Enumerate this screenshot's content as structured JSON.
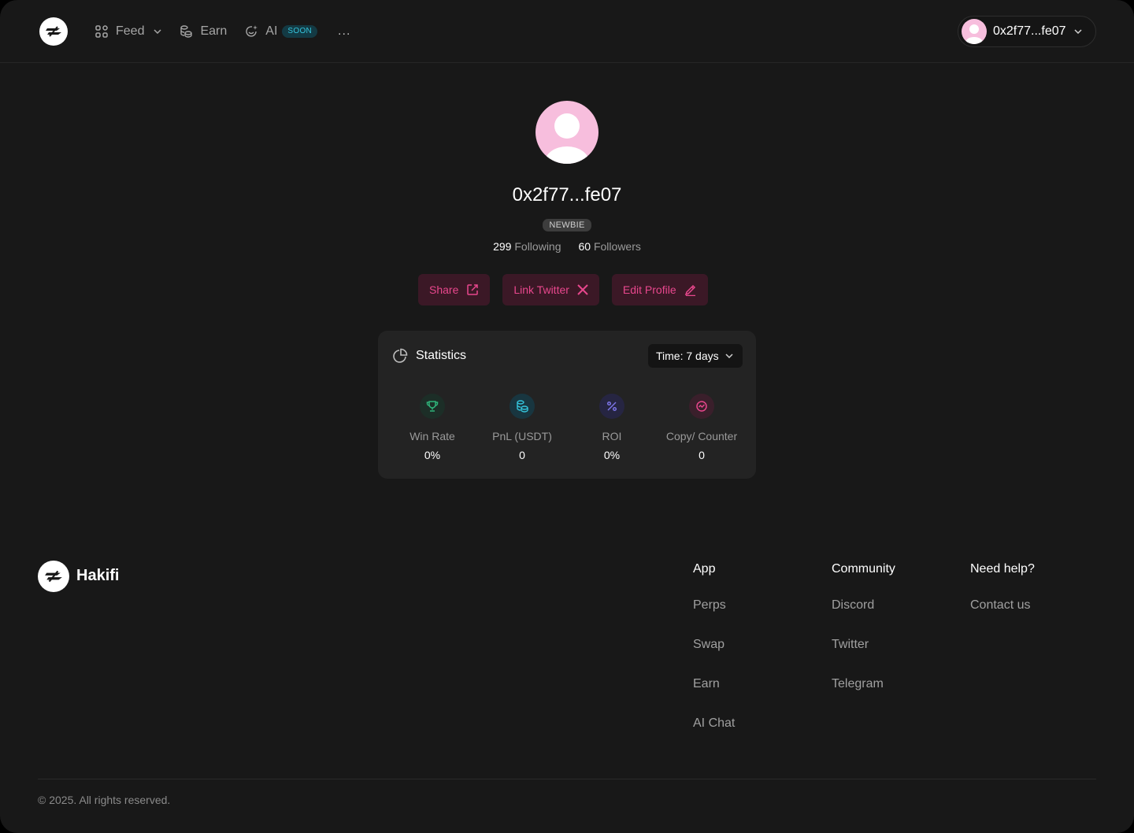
{
  "header": {
    "nav": [
      {
        "label": "Feed",
        "icon": "grid-icon",
        "has_dropdown": true
      },
      {
        "label": "Earn",
        "icon": "coins-icon"
      },
      {
        "label": "AI",
        "icon": "ai-sparkle-icon",
        "badge": "SOON"
      }
    ],
    "more_label": "...",
    "wallet_label": "0x2f77...fe07"
  },
  "profile": {
    "username": "0x2f77...fe07",
    "rank_badge": "NEWBIE",
    "following_count": "299",
    "following_label": "Following",
    "followers_count": "60",
    "followers_label": "Followers",
    "actions": {
      "share": "Share",
      "link_twitter": "Link Twitter",
      "edit_profile": "Edit Profile"
    }
  },
  "statistics": {
    "title": "Statistics",
    "time_select": "Time: 7 days",
    "metrics": [
      {
        "label": "Win Rate",
        "value": "0%",
        "icon": "trophy-icon"
      },
      {
        "label": "PnL (USDT)",
        "value": "0",
        "icon": "coins-icon"
      },
      {
        "label": "ROI",
        "value": "0%",
        "icon": "percent-icon"
      },
      {
        "label": "Copy/ Counter",
        "value": "0",
        "icon": "copy-counter-icon"
      }
    ]
  },
  "footer": {
    "brand": "Hakifi",
    "columns": [
      {
        "heading": "App",
        "links": [
          "Perps",
          "Swap",
          "Earn",
          "AI Chat"
        ]
      },
      {
        "heading": "Community",
        "links": [
          "Discord",
          "Twitter",
          "Telegram"
        ]
      },
      {
        "heading": "Need help?",
        "links": [
          "Contact us"
        ]
      }
    ],
    "copyright": "© 2025. All rights reserved."
  },
  "colors": {
    "background": "#181818",
    "accent": "#e8478d",
    "accent_bg": "#3b1826",
    "card": "#232323",
    "avatar": "#f7bedd"
  }
}
